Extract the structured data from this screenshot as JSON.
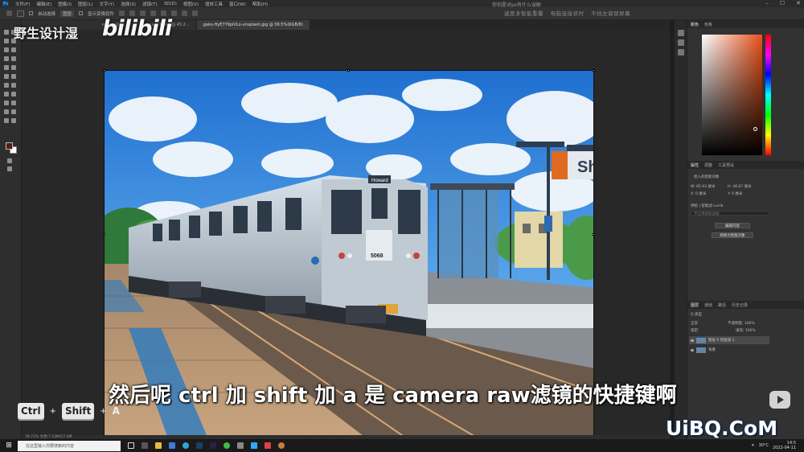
{
  "menubar": {
    "items": [
      "文件(F)",
      "编辑(E)",
      "图像(I)",
      "图层(L)",
      "文字(Y)",
      "选择(S)",
      "滤镜(T)",
      "3D(D)",
      "视图(V)",
      "增效工具",
      "窗口(W)",
      "帮助(H)"
    ],
    "doc_title": "你怕是对ps有什么误解"
  },
  "optionsbar": {
    "auto_select": "自动选择",
    "layer": "图层",
    "show_transform": "显示变换控件"
  },
  "tip_text": [
    "速度多智能重覆",
    "电脑连接状时",
    "不挡左窗那屏幕"
  ],
  "watermark": {
    "channel": "野生设计湿",
    "brand": "bilibili"
  },
  "tabs": [
    {
      "label": "eakam@5...",
      "active": false
    },
    {
      "label": "pesasa... 1.psd @ 45.2...",
      "active": false
    },
    {
      "label": "gaku-HyE7Y9piVLo-unsplash.jpg @ 58.5%(RGB/8)",
      "active": true
    }
  ],
  "status": "78.71%   文档:7.53M/17.4M",
  "panels": {
    "color_tabs": [
      "颜色",
      "色板"
    ],
    "props_tabs": [
      "属性",
      "调整",
      "工具预设"
    ],
    "smart_object": "嵌入的智能对象",
    "w_label": "W: 85.93 厘米",
    "h_label": "H: 46.67 厘米",
    "x_label": "X: 0 厘米",
    "y_label": "Y: 0 厘米",
    "source_label": "供给 | 智能滤 Lunib",
    "no_filter": "不应用智能滤镜",
    "edit_content": "编辑内容",
    "convert_layer": "转换为智能对象",
    "layers_tabs": [
      "图层",
      "通道",
      "路径",
      "历史记录",
      "历史记录"
    ],
    "kind": "Q 类型",
    "mode": "正常",
    "opacity_label": "不透明度: 100%",
    "lock_label": "锁定:",
    "fill_label": "填充: 100%",
    "layers": [
      {
        "name": "图层 0 智能滤 1",
        "selected": true
      },
      {
        "name": "背景",
        "selected": false
      }
    ]
  },
  "subtitle": "然后呢 ctrl 加 shift 加 a 是 camera raw滤镜的快捷键啊",
  "keys": [
    "Ctrl",
    "Shift",
    "A"
  ],
  "key_plus": "+",
  "site_watermark": "UiBQ.CoM",
  "taskbar": {
    "search_placeholder": "在这里输入你要搜索的内容",
    "weather": "30°C",
    "time": "14:5",
    "date": "2022-04-11"
  },
  "photo": {
    "sign_text": "She",
    "route_sign": "Howard",
    "car_number": "5068"
  }
}
